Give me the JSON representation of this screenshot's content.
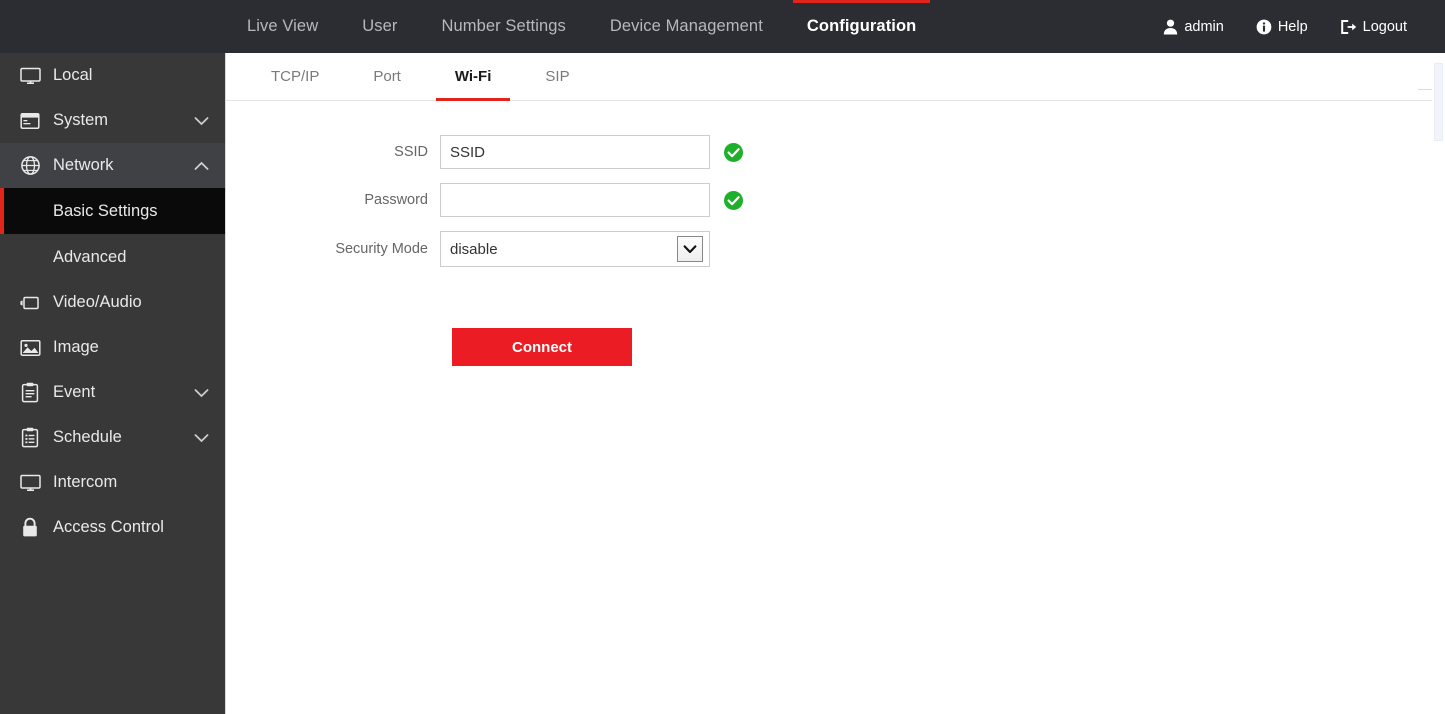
{
  "header": {
    "nav": [
      {
        "label": "Live View",
        "active": false
      },
      {
        "label": "User",
        "active": false
      },
      {
        "label": "Number Settings",
        "active": false
      },
      {
        "label": "Device Management",
        "active": false
      },
      {
        "label": "Configuration",
        "active": true
      }
    ],
    "account": {
      "label": "admin",
      "icon": "user-icon"
    },
    "help": {
      "label": "Help",
      "icon": "info-icon"
    },
    "logout": {
      "label": "Logout",
      "icon": "logout-icon"
    },
    "accent_color": "#e1251b",
    "background_color": "#2b2d33"
  },
  "sidebar": {
    "background_color": "#383838",
    "selected_color": "#0a0a0a",
    "accent_color": "#e1251b",
    "items": [
      {
        "label": "Local",
        "icon": "monitor-icon",
        "chevron": ""
      },
      {
        "label": "System",
        "icon": "window-icon",
        "chevron": "down"
      },
      {
        "label": "Network",
        "icon": "globe-icon",
        "chevron": "up"
      },
      {
        "label": "Video/Audio",
        "icon": "video-icon",
        "chevron": ""
      },
      {
        "label": "Image",
        "icon": "picture-icon",
        "chevron": ""
      },
      {
        "label": "Event",
        "icon": "clipboard-icon",
        "chevron": "down"
      },
      {
        "label": "Schedule",
        "icon": "schedule-icon",
        "chevron": "down"
      },
      {
        "label": "Intercom",
        "icon": "monitor-icon",
        "chevron": ""
      },
      {
        "label": "Access Control",
        "icon": "lock-icon",
        "chevron": ""
      }
    ],
    "network_children": [
      {
        "label": "Basic Settings",
        "selected": true
      },
      {
        "label": "Advanced",
        "selected": false
      }
    ]
  },
  "subtabs": [
    {
      "label": "TCP/IP",
      "active": false
    },
    {
      "label": "Port",
      "active": false
    },
    {
      "label": "Wi-Fi",
      "active": true
    },
    {
      "label": "SIP",
      "active": false
    }
  ],
  "form": {
    "ssid": {
      "label": "SSID",
      "value": "SSID",
      "placeholder": "",
      "status_icon": "check-circle-icon",
      "status_color": "#1eaf2b"
    },
    "password": {
      "label": "Password",
      "value": "",
      "placeholder": "",
      "status_icon": "check-circle-icon",
      "status_color": "#1eaf2b"
    },
    "security_mode": {
      "label": "Security Mode",
      "value": "disable",
      "options": [
        "disable"
      ],
      "dropdown_icon": "chevron-down-icon"
    },
    "connect_button": {
      "label": "Connect",
      "color": "#ec1c24"
    }
  }
}
